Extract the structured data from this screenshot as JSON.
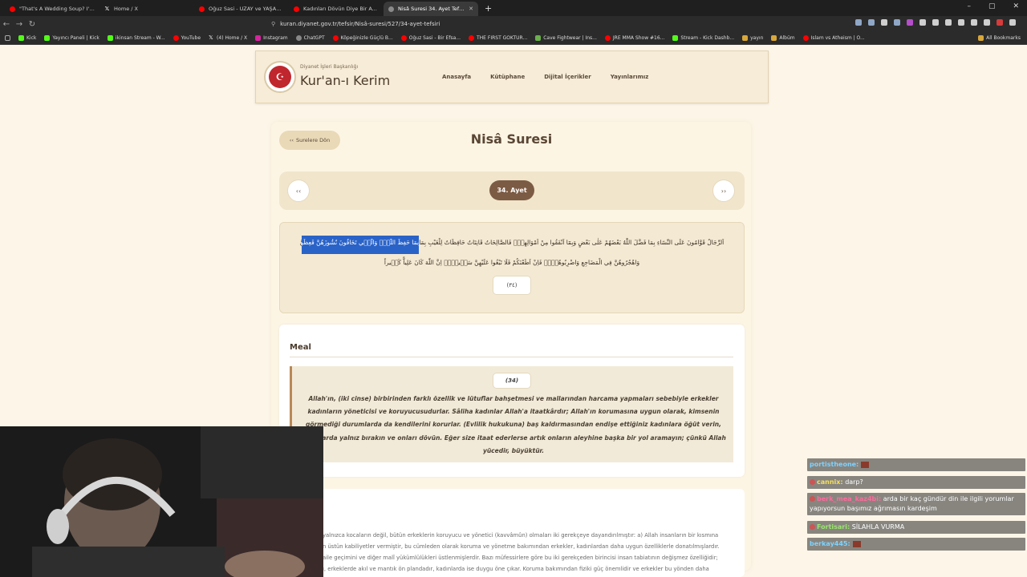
{
  "browser": {
    "tabs": [
      {
        "title": "\"That's A Wedding Soup? I'd Rather",
        "icon": "youtube-icon",
        "active": false
      },
      {
        "title": "Home / X",
        "icon": "x-icon",
        "active": false
      },
      {
        "title": "Oğuz Sasi - UZAY ve YAŞAM Teorileri",
        "icon": "youtube-icon",
        "active": false
      },
      {
        "title": "Kadınları Dövün Diye Bir Ayet Var M",
        "icon": "youtube-icon",
        "active": false
      },
      {
        "title": "Nisâ Suresi 34. Ayet Tefsiri - Diya",
        "icon": "globe-icon",
        "active": true
      }
    ],
    "new_tab": "+",
    "url": "kuran.diyanet.gov.tr/tefsir/Nisâ-suresi/527/34-ayet-tefsiri",
    "bookmarks": [
      {
        "label": "Kick",
        "icon": "kick-icon"
      },
      {
        "label": "Yayıncı Paneli | Kick",
        "icon": "kick-icon"
      },
      {
        "label": "ikinsan Stream - W...",
        "icon": "kick-icon"
      },
      {
        "label": "YouTube",
        "icon": "youtube-icon"
      },
      {
        "label": "(4) Home / X",
        "icon": "x-icon"
      },
      {
        "label": "Instagram",
        "icon": "instagram-icon"
      },
      {
        "label": "ChatGPT",
        "icon": "chatgpt-icon"
      },
      {
        "label": "Köpeğinizle Güçlü B...",
        "icon": "youtube-icon"
      },
      {
        "label": "Oğuz Sasi - Bir Efsa...",
        "icon": "youtube-icon"
      },
      {
        "label": "THE FIRST GOKTUR...",
        "icon": "youtube-icon"
      },
      {
        "label": "Cave Fightwear | Ins...",
        "icon": "leaf-icon"
      },
      {
        "label": "JRE MMA Show #16...",
        "icon": "youtube-icon"
      },
      {
        "label": "Stream - Kick Dashb...",
        "icon": "kick-icon"
      },
      {
        "label": "yayın",
        "icon": "folder-icon"
      },
      {
        "label": "Albüm",
        "icon": "folder-icon"
      },
      {
        "label": "Islam vs Atheism | O...",
        "icon": "youtube-icon"
      }
    ],
    "all_bookmarks": "All Bookmarks"
  },
  "site": {
    "brand_sub": "Diyanet İşleri Başkanlığı",
    "brand_title": "Kur'an-ı Kerim",
    "nav": [
      "Anasayfa",
      "Kütüphane",
      "Dijital İçerikler",
      "Yayınlarımız"
    ]
  },
  "page": {
    "back_label": "Surelere Dön",
    "sure_title": "Nisâ Suresi",
    "prev": "‹‹",
    "next": "››",
    "ayet_label": "34. Ayet",
    "arabic_line1": "اَلرِّجَالُ قَوَّامُونَ عَلَى النِّسَٓاءِ بِمَا فَضَّلَ اللّٰهُ بَعْضَهُمْ عَلٰى بَعْضٍ وَبِمَٓا اَنْفَقُوا مِنْ اَمْوَالِهِمْۜ فَالصَّالِحَاتُ قَانِتَاتٌ حَافِظَاتٌ لِلْغَيْبِ بِمَا حَفِظَ اللّٰهُۜ وَالّٰت۪ي تَخَافُونَ نُشُوزَهُنَّ فَعِظُوهُنَّ",
    "arabic_selected": "بِمَا حَفِظَ اللّٰهُۜ وَالّٰت۪ي تَخَافُونَ نُشُوزَهُنَّ فَعِظُوهُنَّ",
    "arabic_line2": "وَاهْجُرُوهُنَّ فِي الْمَضَاجِعِ وَاضْرِبُوهُنَّۚ فَاِنْ اَطَعْنَكُمْ فَلَا تَبْغُوا عَلَيْهِنَّ سَب۪يلاًۜ اِنَّ اللّٰهَ كَانَ عَلِياًّ كَب۪يراً",
    "ayah_number": "(٣٤)",
    "meal_title": "Meal",
    "meal_number": "(34)",
    "meal_text": "Allah'ın, (iki cinse) birbirinden farklı özellik ve lütuflar bahşetmesi ve mallarından harcama yapmaları sebebiyle erkekler kadınların yöneticisi ve koruyucusudurlar. Sâliha kadınlar Allah'a itaatkârdır; Allah'ın korumasına uygun olarak, kimsenin görmediği durumlarda da kendilerini korurlar. (Evlilik hukukuna) baş kaldırmasından endişe ettiğiniz kadınlara öğüt verin, yataklarda yalnız bırakın ve onları dövün. Eğer size itaat ederlerse artık onların aleyhine başka bir yol aramayın; çünkü Allah yücedir, büyüktür.",
    "tefsir_lines": [
      "yalnızca kocaların değil, bütün erkeklerin koruyucu ve yönetici (kavvâmûn) olmaları iki gerekçeye dayandırılmıştır: a) Allah insanların bir kısmına",
      "n üstün kabiliyetler vermiştir, bu cümleden olarak koruma ve yönetme bakımından erkekler, kadınlardan daha uygun özelliklerle donatılmışlardır.",
      "aile geçimini ve diğer malî yükümlülükleri üstlenmişlerdir. Bazı müfessirlere göre bu iki gerekçeden birincisi insan tabiatının değişmez özelliğidir;",
      "ı, erkeklerde akıl ve mantık ön plandadır, kadınlarda ise duygu öne çıkar. Koruma bakımından fiziki güç önemlidir ve erkekler bu yönden daha"
    ]
  },
  "chat": [
    {
      "user": "portistheone:",
      "text": "",
      "user_color": "#7ed3ff",
      "emote": true
    },
    {
      "user": "cannix:",
      "text": "darp?",
      "user_color": "#f6e05e",
      "emote": false
    },
    {
      "user": "berk_mea_kaz4bi:",
      "text": "arda bir kaç gündür din ile ilgili yorumlar yapıyorsun başımız ağrımasın kardeşim",
      "user_color": "#ff6b9d",
      "emote": false
    },
    {
      "user": "Fortisari:",
      "text": "SİLAHLA VURMA",
      "user_color": "#9ae66e",
      "emote": false
    },
    {
      "user": "berkay445:",
      "text": "",
      "user_color": "#7ed3ff",
      "emote": true
    }
  ]
}
